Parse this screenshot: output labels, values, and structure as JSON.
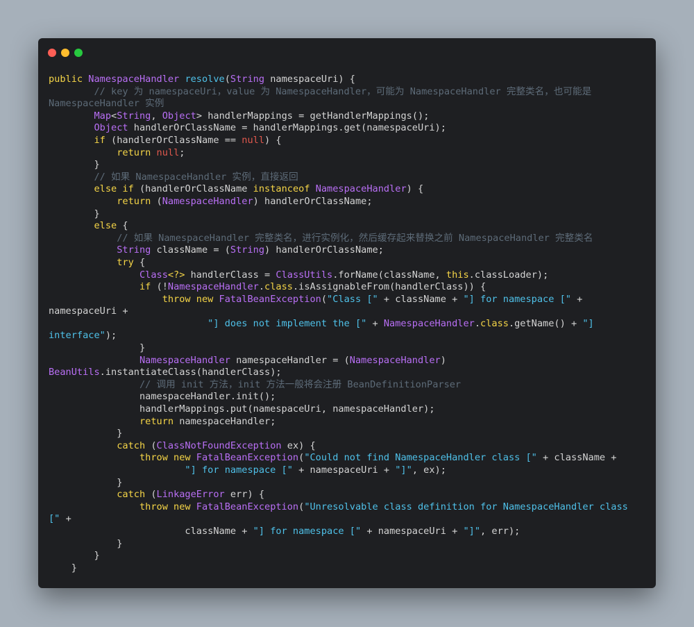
{
  "window": {
    "controls": [
      "close",
      "minimize",
      "maximize"
    ],
    "colors": {
      "background": "#1e1f22",
      "close": "#ff5f56",
      "minimize": "#ffbd2e",
      "maximize": "#27c93f"
    }
  },
  "code": {
    "language": "java",
    "lines": [
      [
        [
          "kw",
          "public "
        ],
        [
          "ty",
          "NamespaceHandler "
        ],
        [
          "fn",
          "resolve"
        ],
        [
          "pl",
          "("
        ],
        [
          "ty",
          "String "
        ],
        [
          "pl",
          "namespaceUri) {"
        ]
      ],
      [
        [
          "pl",
          "        "
        ],
        [
          "cm",
          "// key 为 namespaceUri，value 为 NamespaceHandler，可能为 NamespaceHandler 完整类名，也可能是"
        ]
      ],
      [
        [
          "cm",
          "NamespaceHandler 实例"
        ]
      ],
      [
        [
          "pl",
          "        "
        ],
        [
          "ty",
          "Map"
        ],
        [
          "pl",
          "<"
        ],
        [
          "ty",
          "String"
        ],
        [
          "pl",
          ", "
        ],
        [
          "ty",
          "Object"
        ],
        [
          "pl",
          "> handlerMappings = getHandlerMappings();"
        ]
      ],
      [
        [
          "pl",
          "        "
        ],
        [
          "ty",
          "Object "
        ],
        [
          "pl",
          "handlerOrClassName = handlerMappings.get(namespaceUri);"
        ]
      ],
      [
        [
          "pl",
          "        "
        ],
        [
          "kw",
          "if "
        ],
        [
          "pl",
          "(handlerOrClassName == "
        ],
        [
          "nu",
          "null"
        ],
        [
          "pl",
          ") {"
        ]
      ],
      [
        [
          "pl",
          "            "
        ],
        [
          "kw",
          "return "
        ],
        [
          "nu",
          "null"
        ],
        [
          "pl",
          ";"
        ]
      ],
      [
        [
          "pl",
          "        }"
        ]
      ],
      [
        [
          "pl",
          "        "
        ],
        [
          "cm",
          "// 如果 NamespaceHandler 实例，直接返回"
        ]
      ],
      [
        [
          "pl",
          "        "
        ],
        [
          "kw",
          "else if "
        ],
        [
          "pl",
          "(handlerOrClassName "
        ],
        [
          "kw",
          "instanceof "
        ],
        [
          "ty",
          "NamespaceHandler"
        ],
        [
          "pl",
          ") {"
        ]
      ],
      [
        [
          "pl",
          "            "
        ],
        [
          "kw",
          "return "
        ],
        [
          "pl",
          "("
        ],
        [
          "ty",
          "NamespaceHandler"
        ],
        [
          "pl",
          ") handlerOrClassName;"
        ]
      ],
      [
        [
          "pl",
          "        }"
        ]
      ],
      [
        [
          "pl",
          "        "
        ],
        [
          "kw",
          "else "
        ],
        [
          "pl",
          "{"
        ]
      ],
      [
        [
          "pl",
          "            "
        ],
        [
          "cm",
          "// 如果 NamespaceHandler 完整类名，进行实例化，然后缓存起来替换之前 NamespaceHandler 完整类名"
        ]
      ],
      [
        [
          "pl",
          "            "
        ],
        [
          "ty",
          "String "
        ],
        [
          "pl",
          "className = ("
        ],
        [
          "ty",
          "String"
        ],
        [
          "pl",
          ") handlerOrClassName;"
        ]
      ],
      [
        [
          "pl",
          "            "
        ],
        [
          "kw",
          "try "
        ],
        [
          "pl",
          "{"
        ]
      ],
      [
        [
          "pl",
          "                "
        ],
        [
          "ty",
          "Class"
        ],
        [
          "op",
          "<?> "
        ],
        [
          "pl",
          "handlerClass = "
        ],
        [
          "ty",
          "ClassUtils"
        ],
        [
          "pl",
          ".forName(className, "
        ],
        [
          "kw",
          "this"
        ],
        [
          "pl",
          ".classLoader);"
        ]
      ],
      [
        [
          "pl",
          "                "
        ],
        [
          "kw",
          "if "
        ],
        [
          "pl",
          "(!"
        ],
        [
          "ty",
          "NamespaceHandler"
        ],
        [
          "pl",
          "."
        ],
        [
          "kw",
          "class"
        ],
        [
          "pl",
          ".isAssignableFrom(handlerClass)) {"
        ]
      ],
      [
        [
          "pl",
          "                    "
        ],
        [
          "kw",
          "throw new "
        ],
        [
          "ty",
          "FatalBeanException"
        ],
        [
          "pl",
          "("
        ],
        [
          "st",
          "\"Class [\" "
        ],
        [
          "pl",
          "+ className + "
        ],
        [
          "st",
          "\"] for namespace [\" "
        ],
        [
          "pl",
          "+"
        ]
      ],
      [
        [
          "pl",
          "namespaceUri +"
        ]
      ],
      [
        [
          "pl",
          "                            "
        ],
        [
          "st",
          "\"] does not implement the [\" "
        ],
        [
          "pl",
          "+ "
        ],
        [
          "ty",
          "NamespaceHandler"
        ],
        [
          "pl",
          "."
        ],
        [
          "kw",
          "class"
        ],
        [
          "pl",
          ".getName() + "
        ],
        [
          "st",
          "\"]"
        ]
      ],
      [
        [
          "st",
          "interface\""
        ],
        [
          "pl",
          ");"
        ]
      ],
      [
        [
          "pl",
          "                }"
        ]
      ],
      [
        [
          "pl",
          "                "
        ],
        [
          "ty",
          "NamespaceHandler "
        ],
        [
          "pl",
          "namespaceHandler = ("
        ],
        [
          "ty",
          "NamespaceHandler"
        ],
        [
          "pl",
          ")"
        ]
      ],
      [
        [
          "ty",
          "BeanUtils"
        ],
        [
          "pl",
          ".instantiateClass(handlerClass);"
        ]
      ],
      [
        [
          "pl",
          "                "
        ],
        [
          "cm",
          "// 调用 init 方法，init 方法一般将会注册 BeanDefinitionParser"
        ]
      ],
      [
        [
          "pl",
          "                namespaceHandler.init();"
        ]
      ],
      [
        [
          "pl",
          "                handlerMappings.put(namespaceUri, namespaceHandler);"
        ]
      ],
      [
        [
          "pl",
          "                "
        ],
        [
          "kw",
          "return "
        ],
        [
          "pl",
          "namespaceHandler;"
        ]
      ],
      [
        [
          "pl",
          "            }"
        ]
      ],
      [
        [
          "pl",
          "            "
        ],
        [
          "kw",
          "catch "
        ],
        [
          "pl",
          "("
        ],
        [
          "ty",
          "ClassNotFoundException "
        ],
        [
          "pl",
          "ex) {"
        ]
      ],
      [
        [
          "pl",
          "                "
        ],
        [
          "kw",
          "throw new "
        ],
        [
          "ty",
          "FatalBeanException"
        ],
        [
          "pl",
          "("
        ],
        [
          "st",
          "\"Could not find NamespaceHandler class [\" "
        ],
        [
          "pl",
          "+ className +"
        ]
      ],
      [
        [
          "pl",
          "                        "
        ],
        [
          "st",
          "\"] for namespace [\" "
        ],
        [
          "pl",
          "+ namespaceUri + "
        ],
        [
          "st",
          "\"]\""
        ],
        [
          "pl",
          ", ex);"
        ]
      ],
      [
        [
          "pl",
          "            }"
        ]
      ],
      [
        [
          "pl",
          "            "
        ],
        [
          "kw",
          "catch "
        ],
        [
          "pl",
          "("
        ],
        [
          "ty",
          "LinkageError "
        ],
        [
          "pl",
          "err) {"
        ]
      ],
      [
        [
          "pl",
          "                "
        ],
        [
          "kw",
          "throw new "
        ],
        [
          "ty",
          "FatalBeanException"
        ],
        [
          "pl",
          "("
        ],
        [
          "st",
          "\"Unresolvable class definition for NamespaceHandler class"
        ]
      ],
      [
        [
          "st",
          "[\" "
        ],
        [
          "pl",
          "+"
        ]
      ],
      [
        [
          "pl",
          "                        className + "
        ],
        [
          "st",
          "\"] for namespace [\" "
        ],
        [
          "pl",
          "+ namespaceUri + "
        ],
        [
          "st",
          "\"]\""
        ],
        [
          "pl",
          ", err);"
        ]
      ],
      [
        [
          "pl",
          "            }"
        ]
      ],
      [
        [
          "pl",
          "        }"
        ]
      ],
      [
        [
          "pl",
          "    }"
        ]
      ]
    ]
  }
}
